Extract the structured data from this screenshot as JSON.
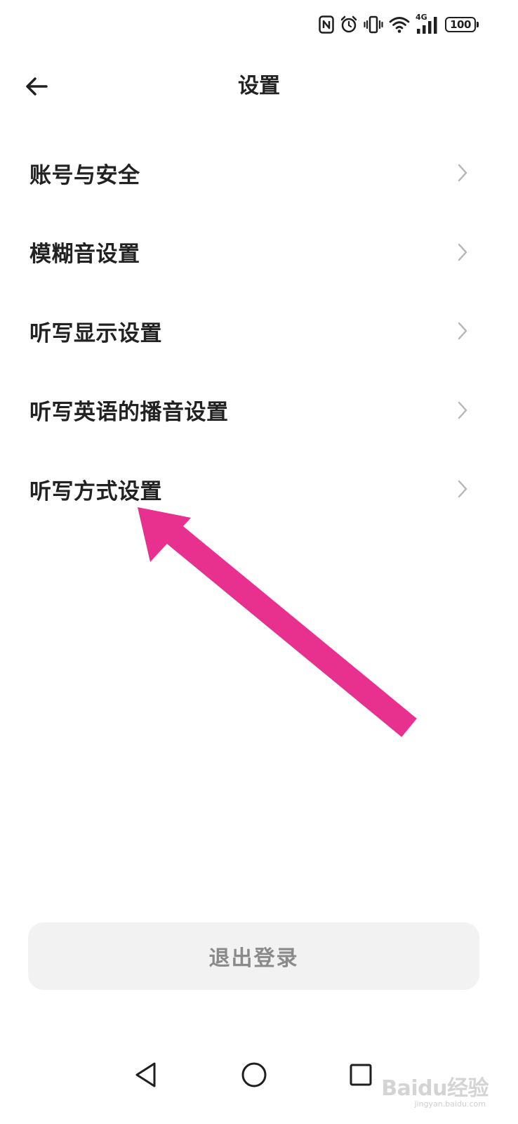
{
  "status_bar": {
    "icons": [
      "nfc-icon",
      "alarm-icon",
      "vibrate-icon",
      "wifi-icon",
      "signal-4g-icon",
      "battery-icon"
    ],
    "network_label": "4G",
    "battery_level": "100"
  },
  "header": {
    "back_icon": "arrow-left-icon",
    "title": "设置"
  },
  "menu": {
    "items": [
      {
        "label": "账号与安全"
      },
      {
        "label": "模糊音设置"
      },
      {
        "label": "听写显示设置"
      },
      {
        "label": "听写英语的播音设置"
      },
      {
        "label": "听写方式设置"
      }
    ],
    "chevron_icon": "chevron-right-icon"
  },
  "annotation": {
    "arrow_color": "#e8318f",
    "points_to": "听写方式设置"
  },
  "logout": {
    "label": "退出登录"
  },
  "nav_bar": {
    "icons": [
      "back-triangle-icon",
      "home-circle-icon",
      "recents-square-icon"
    ]
  },
  "watermark": {
    "brand": "Baidu经验",
    "site": "jingyan.baidu.com"
  },
  "colors": {
    "text_primary": "#222222",
    "logout_bg": "#f2f2f2",
    "logout_text": "#8a8a8a",
    "chevron": "#b5b5b5",
    "annotation": "#e8318f"
  }
}
